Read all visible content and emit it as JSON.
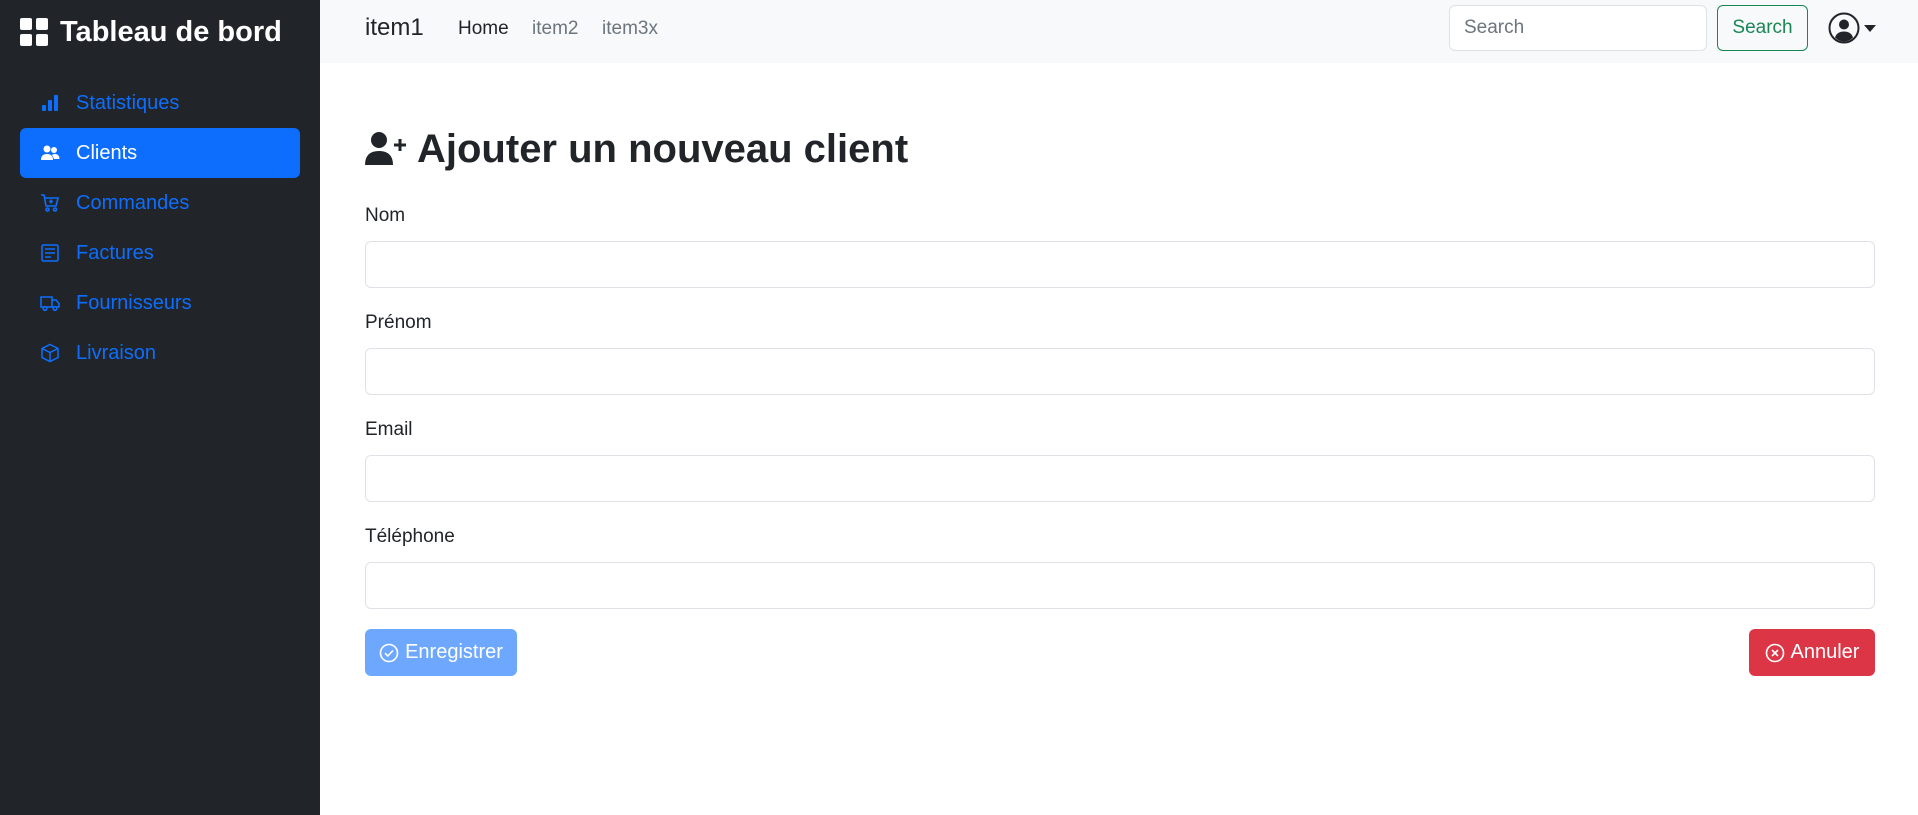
{
  "sidebar": {
    "brand": "Tableau de bord",
    "brand_icon": "grid-icon",
    "items": [
      {
        "label": "Statistiques",
        "icon": "bar-chart-icon",
        "active": false
      },
      {
        "label": "Clients",
        "icon": "users-icon",
        "active": true
      },
      {
        "label": "Commandes",
        "icon": "cart-icon",
        "active": false
      },
      {
        "label": "Factures",
        "icon": "invoice-icon",
        "active": false
      },
      {
        "label": "Fournisseurs",
        "icon": "truck-icon",
        "active": false
      },
      {
        "label": "Livraison",
        "icon": "box-icon",
        "active": false
      }
    ]
  },
  "topbar": {
    "brand": "item1",
    "links": [
      {
        "label": "Home",
        "active": true
      },
      {
        "label": "item2",
        "active": false
      },
      {
        "label": "item3x",
        "active": false
      }
    ],
    "search_placeholder": "Search",
    "search_button": "Search",
    "user_icon": "user-circle-icon"
  },
  "form": {
    "title": "Ajouter un nouveau client",
    "title_icon": "user-plus-icon",
    "fields": [
      {
        "label": "Nom",
        "value": ""
      },
      {
        "label": "Prénom",
        "value": ""
      },
      {
        "label": "Email",
        "value": ""
      },
      {
        "label": "Téléphone",
        "value": ""
      }
    ],
    "save_label": "Enregistrer",
    "cancel_label": "Annuler"
  },
  "colors": {
    "sidebar_bg": "#212529",
    "accent": "#0d6efd",
    "success": "#198754",
    "danger": "#dc3545",
    "save_button": "#6ea8fe"
  }
}
